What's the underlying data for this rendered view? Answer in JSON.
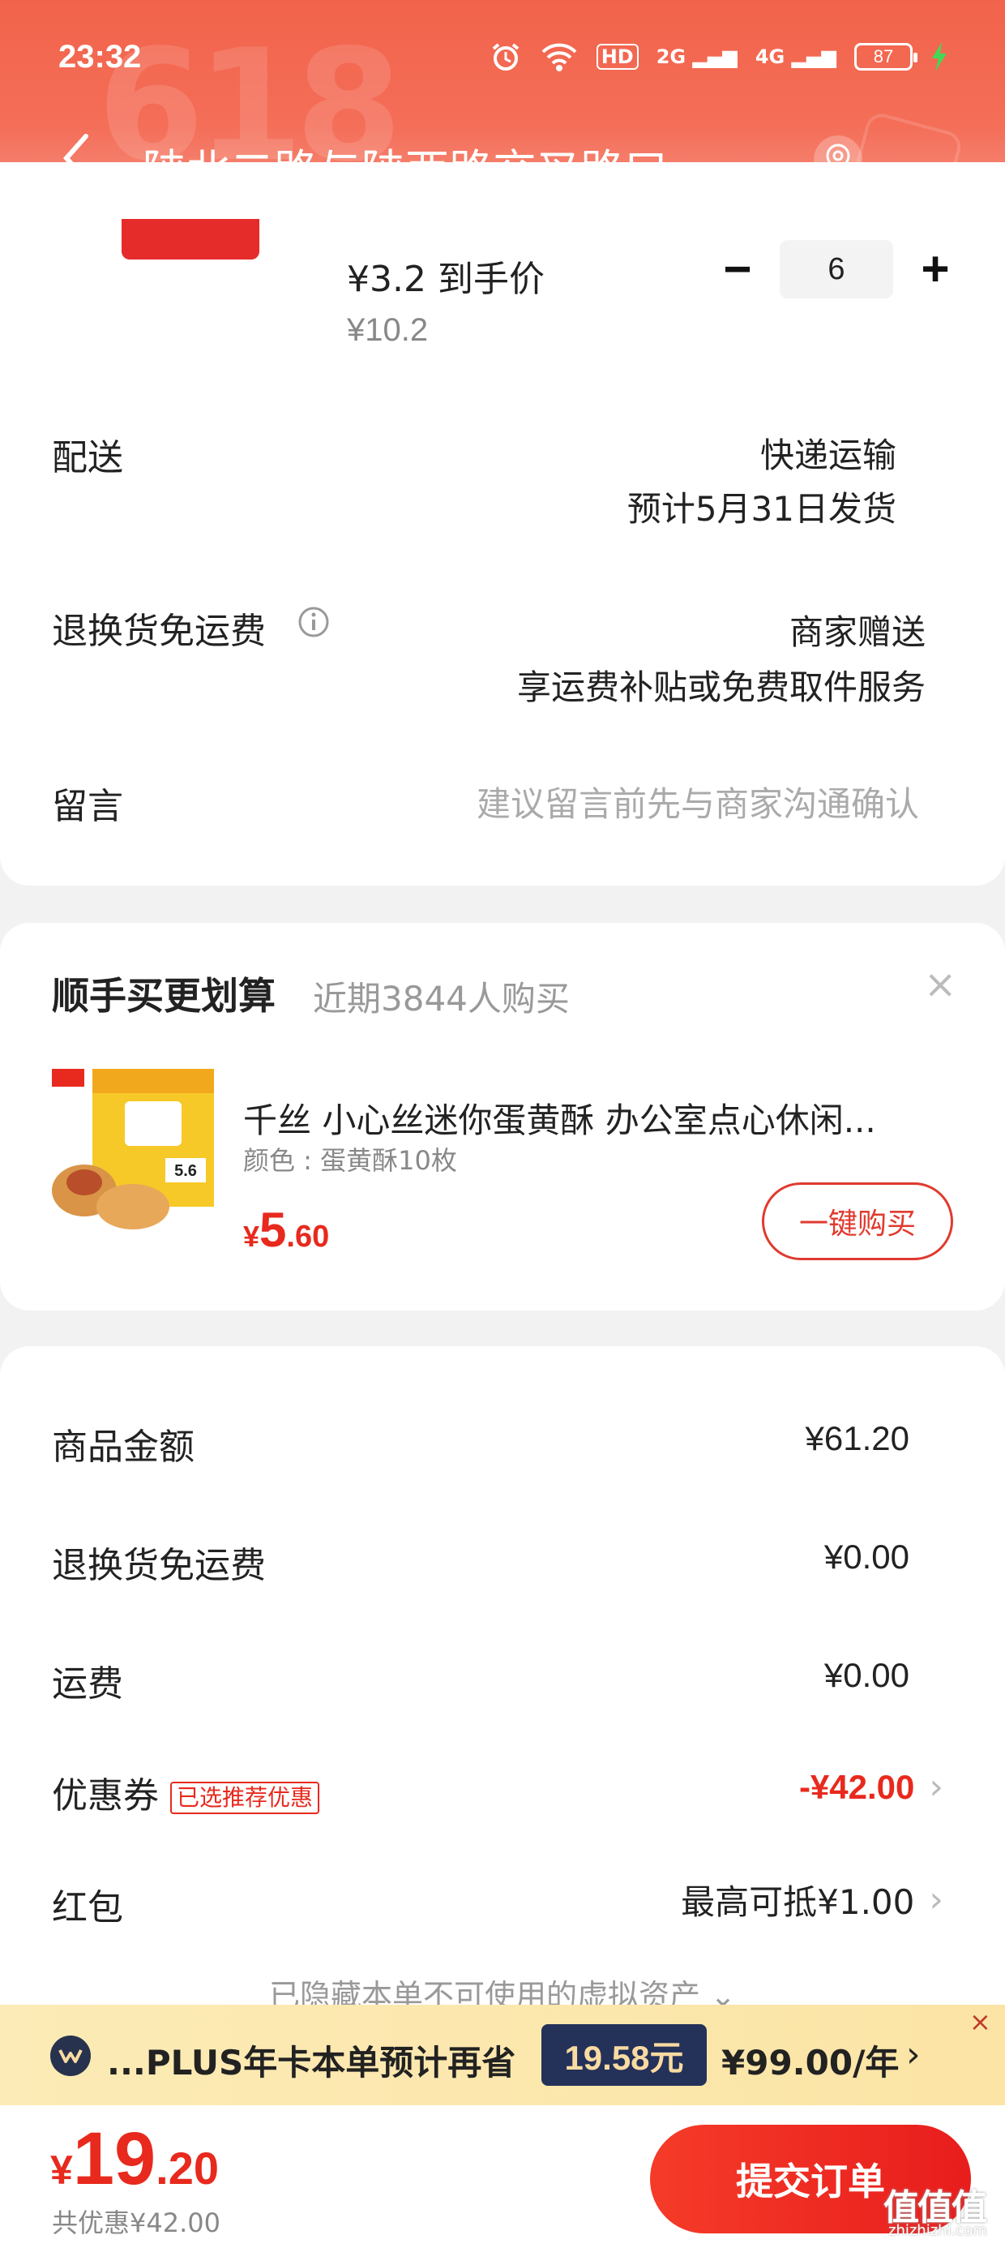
{
  "status_bar": {
    "time": "23:32",
    "battery": "87",
    "hd": "HD",
    "net1": "2G",
    "net2": "4G"
  },
  "header": {
    "address": "陕北二路与陕西路交叉路口...",
    "bg_color": "#f2634b"
  },
  "product": {
    "price_label": "¥3.2 到手价",
    "original_price": "¥10.2",
    "quantity": "6",
    "minus": "−",
    "plus": "+"
  },
  "delivery": {
    "label": "配送",
    "method": "快递运输",
    "eta": "预计5月31日发货"
  },
  "return_fee": {
    "label": "退换货免运费",
    "value_1": "商家赠送",
    "value_2": "享运费补贴或免费取件服务"
  },
  "message": {
    "label": "留言",
    "placeholder": "建议留言前先与商家沟通确认"
  },
  "addon": {
    "title": "顺手买更划算",
    "subtitle": "近期3844人购买",
    "close": "×",
    "item_name": "千丝 小心丝迷你蛋黄酥 办公室点心休闲...",
    "item_spec": "颜色 : 蛋黄酥10枚",
    "price_symbol": "¥",
    "price_int": "5",
    "price_dec": ".60",
    "buy_button": "一键购买",
    "img_badge": "5.6"
  },
  "summary": {
    "goods_label": "商品金额",
    "goods_value": "¥61.20",
    "return_label": "退换货免运费",
    "return_value": "¥0.00",
    "shipping_label": "运费",
    "shipping_value": "¥0.00",
    "coupon_label": "优惠券",
    "coupon_tag": "已选推荐优惠",
    "coupon_value": "-¥42.00",
    "redpacket_label": "红包",
    "redpacket_value": "最高可抵¥1.00",
    "hidden_note": "已隐藏本单不可使用的虚拟资产 ⌄"
  },
  "plus": {
    "text": "...PLUS年卡本单预计再省",
    "badge": "19.58元",
    "price": "¥99.00/年",
    "arrow": "›",
    "close": "×"
  },
  "bottom": {
    "currency": "¥",
    "total_int": "19",
    "total_dec": ".20",
    "saved": "共优惠¥42.00",
    "submit": "提交订单",
    "watermark": "值值值",
    "watermark_url": "zhizhizhi.com"
  },
  "colors": {
    "accent": "#e8291d",
    "plus_badge": "#243159"
  }
}
